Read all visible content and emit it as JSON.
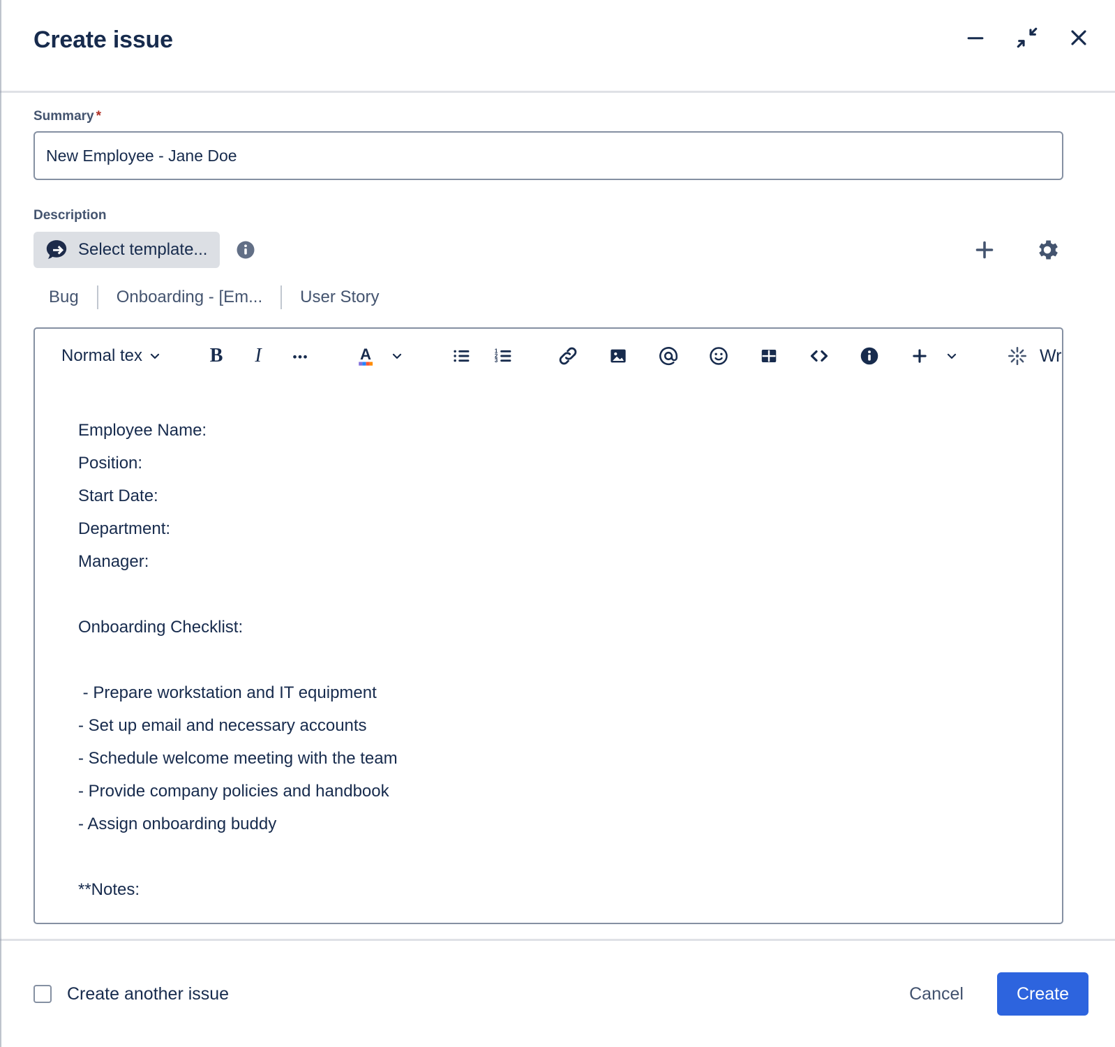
{
  "header": {
    "title": "Create issue",
    "minimize_label": "Minimize",
    "collapse_label": "Collapse",
    "close_label": "Close"
  },
  "summary": {
    "label": "Summary",
    "required_marker": "*",
    "value": "New Employee - Jane Doe",
    "placeholder": ""
  },
  "description": {
    "label": "Description",
    "select_template_label": "Select template...",
    "tabs": [
      {
        "label": "Bug"
      },
      {
        "label": "Onboarding - [Em..."
      },
      {
        "label": "User Story"
      }
    ]
  },
  "toolbar": {
    "text_style": "Normal tex",
    "bold_label": "B",
    "italic_label": "I",
    "more_label": "•••",
    "text_color_label": "A",
    "write_label": "Write"
  },
  "editor_content": {
    "lines": [
      "Employee Name:",
      "Position:",
      "Start Date:",
      "Department:",
      "Manager:",
      "",
      "Onboarding Checklist:",
      "",
      " - Prepare workstation and IT equipment",
      "- Set up email and necessary accounts",
      "- Schedule welcome meeting with the team",
      "- Provide company policies and handbook",
      "- Assign onboarding buddy",
      "",
      "**Notes:"
    ]
  },
  "footer": {
    "create_another_label": "Create another issue",
    "cancel_label": "Cancel",
    "create_label": "Create"
  },
  "colors": {
    "primary_blue": "#2D64DE",
    "text": "#172B4D",
    "muted_text": "#44546F",
    "border": "#8590A2",
    "divider": "#DFE1E6",
    "required_red": "#AE2E24",
    "template_btn_bg": "#DCDFE4"
  }
}
